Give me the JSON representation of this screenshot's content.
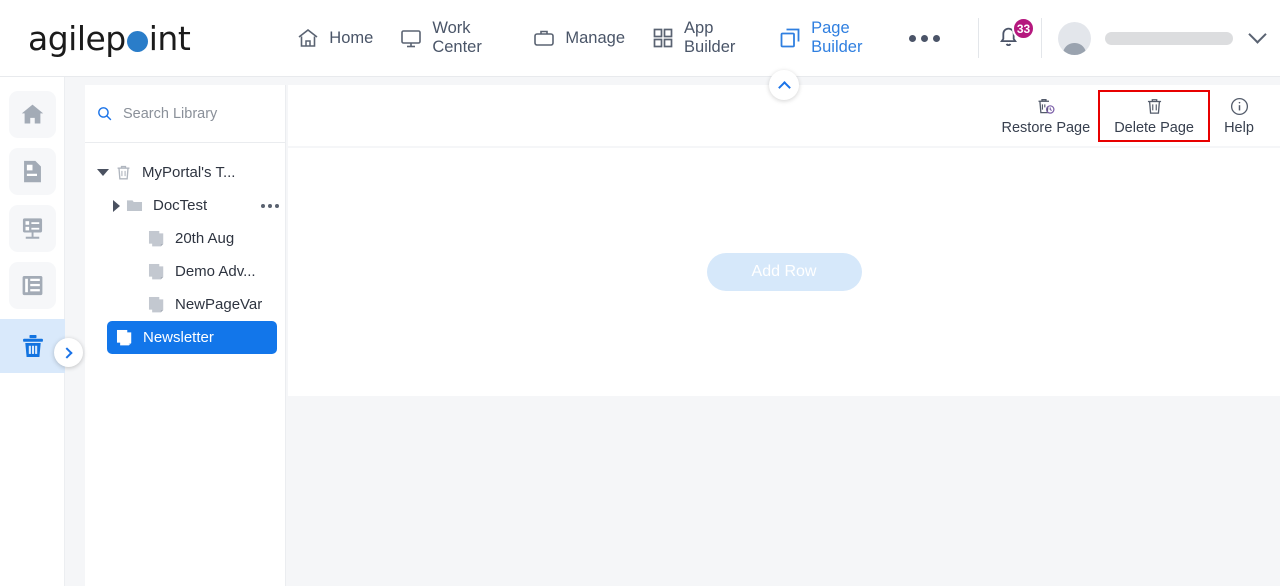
{
  "header": {
    "logo": {
      "text_before": "agilep",
      "text_after": "int",
      "dot_color": "#2a7dc9"
    },
    "nav": [
      {
        "label": "Home",
        "icon": "home-icon",
        "active": false
      },
      {
        "label": "Work Center",
        "icon": "monitor-icon",
        "active": false
      },
      {
        "label": "Manage",
        "icon": "briefcase-icon",
        "active": false
      },
      {
        "label": "App Builder",
        "icon": "grid-icon",
        "active": false
      },
      {
        "label": "Page Builder",
        "icon": "pages-icon",
        "active": true
      }
    ],
    "more_label": "More",
    "notification_count": "33",
    "user_name": ""
  },
  "rail": {
    "items": [
      {
        "name": "home",
        "icon": "home-icon",
        "active": false
      },
      {
        "name": "pages",
        "icon": "page-icon",
        "active": false
      },
      {
        "name": "forms",
        "icon": "form-icon",
        "active": false
      },
      {
        "name": "layouts",
        "icon": "layout-icon",
        "active": false
      },
      {
        "name": "recycle-bin",
        "icon": "trash-icon",
        "active": true
      }
    ]
  },
  "library": {
    "search": {
      "placeholder": "Search Library",
      "value": ""
    },
    "tree": [
      {
        "label": "MyPortal's T...",
        "icon": "trash-icon",
        "expander": "down",
        "depth": 0,
        "selected": false,
        "has_menu": false
      },
      {
        "label": "DocTest",
        "icon": "folder-icon",
        "expander": "right",
        "depth": 1,
        "selected": false,
        "has_menu": true
      },
      {
        "label": "20th Aug",
        "icon": "page-icon",
        "expander": "none",
        "depth": 2,
        "selected": false,
        "has_menu": false
      },
      {
        "label": "Demo Adv...",
        "icon": "page-icon",
        "expander": "none",
        "depth": 2,
        "selected": false,
        "has_menu": false
      },
      {
        "label": "NewPageVar",
        "icon": "page-icon",
        "expander": "none",
        "depth": 2,
        "selected": false,
        "has_menu": false
      },
      {
        "label": "Newsletter",
        "icon": "page-icon",
        "expander": "none",
        "depth": 2,
        "selected": true,
        "has_menu": false
      }
    ]
  },
  "toolbar": {
    "restore_label": "Restore Page",
    "delete_label": "Delete Page",
    "help_label": "Help",
    "highlight_color": "#e80000"
  },
  "canvas": {
    "add_row_label": "Add Row"
  }
}
